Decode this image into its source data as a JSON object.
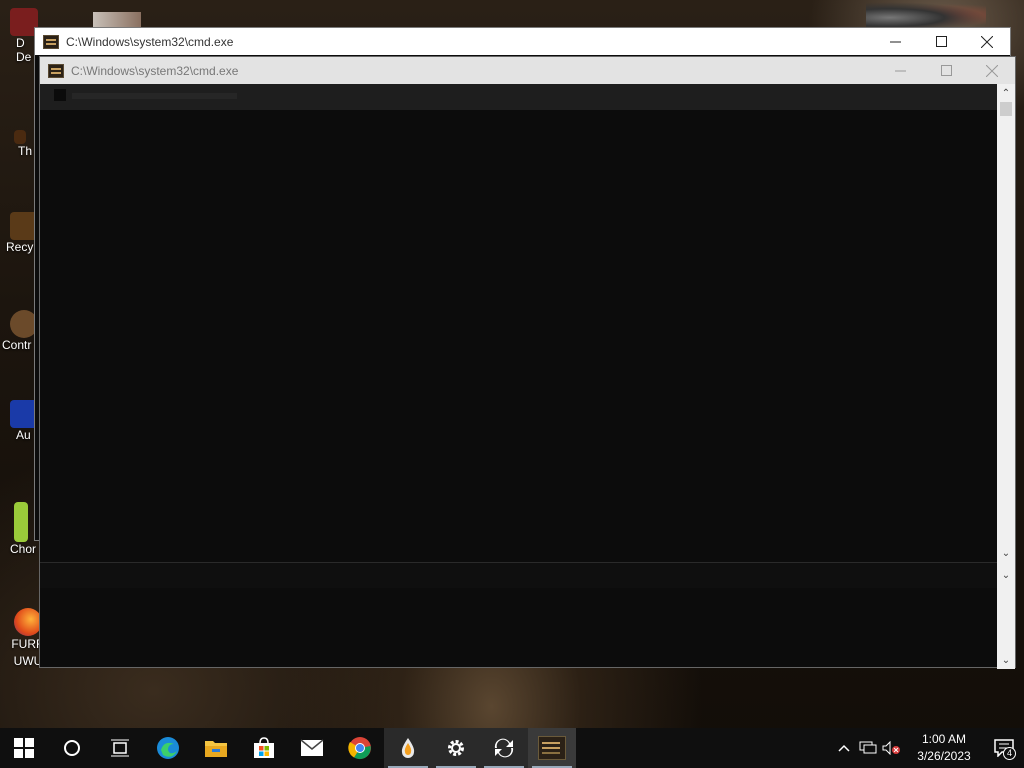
{
  "desktop": {
    "icons": [
      {
        "label": "D\nDe"
      },
      {
        "label": "Th"
      },
      {
        "label": "Recy"
      },
      {
        "label": "Contr"
      },
      {
        "label": "Au"
      },
      {
        "label": "Chor"
      },
      {
        "label": "FURR\nUWU"
      }
    ]
  },
  "outer_window": {
    "title": "C:\\Windows\\system32\\cmd.exe"
  },
  "inner_window": {
    "title": "C:\\Windows\\system32\\cmd.exe"
  },
  "taskbar": {
    "clock_time": "1:00 AM",
    "clock_date": "3/26/2023",
    "notification_count": "4",
    "items": [
      {
        "name": "start-button",
        "icon": "windows-icon"
      },
      {
        "name": "search-button",
        "icon": "cortana-circle-icon"
      },
      {
        "name": "task-view-button",
        "icon": "task-view-icon"
      },
      {
        "name": "edge-button",
        "icon": "edge-icon"
      },
      {
        "name": "file-explorer-button",
        "icon": "folder-icon"
      },
      {
        "name": "store-button",
        "icon": "store-icon"
      },
      {
        "name": "mail-button",
        "icon": "mail-icon"
      },
      {
        "name": "chrome-button",
        "icon": "chrome-icon"
      },
      {
        "name": "water-drop-app-button",
        "icon": "drop-icon"
      },
      {
        "name": "settings-button",
        "icon": "gear-icon"
      },
      {
        "name": "sync-app-button",
        "icon": "sync-icon"
      },
      {
        "name": "cmd-button",
        "icon": "cmd-icon"
      }
    ]
  }
}
